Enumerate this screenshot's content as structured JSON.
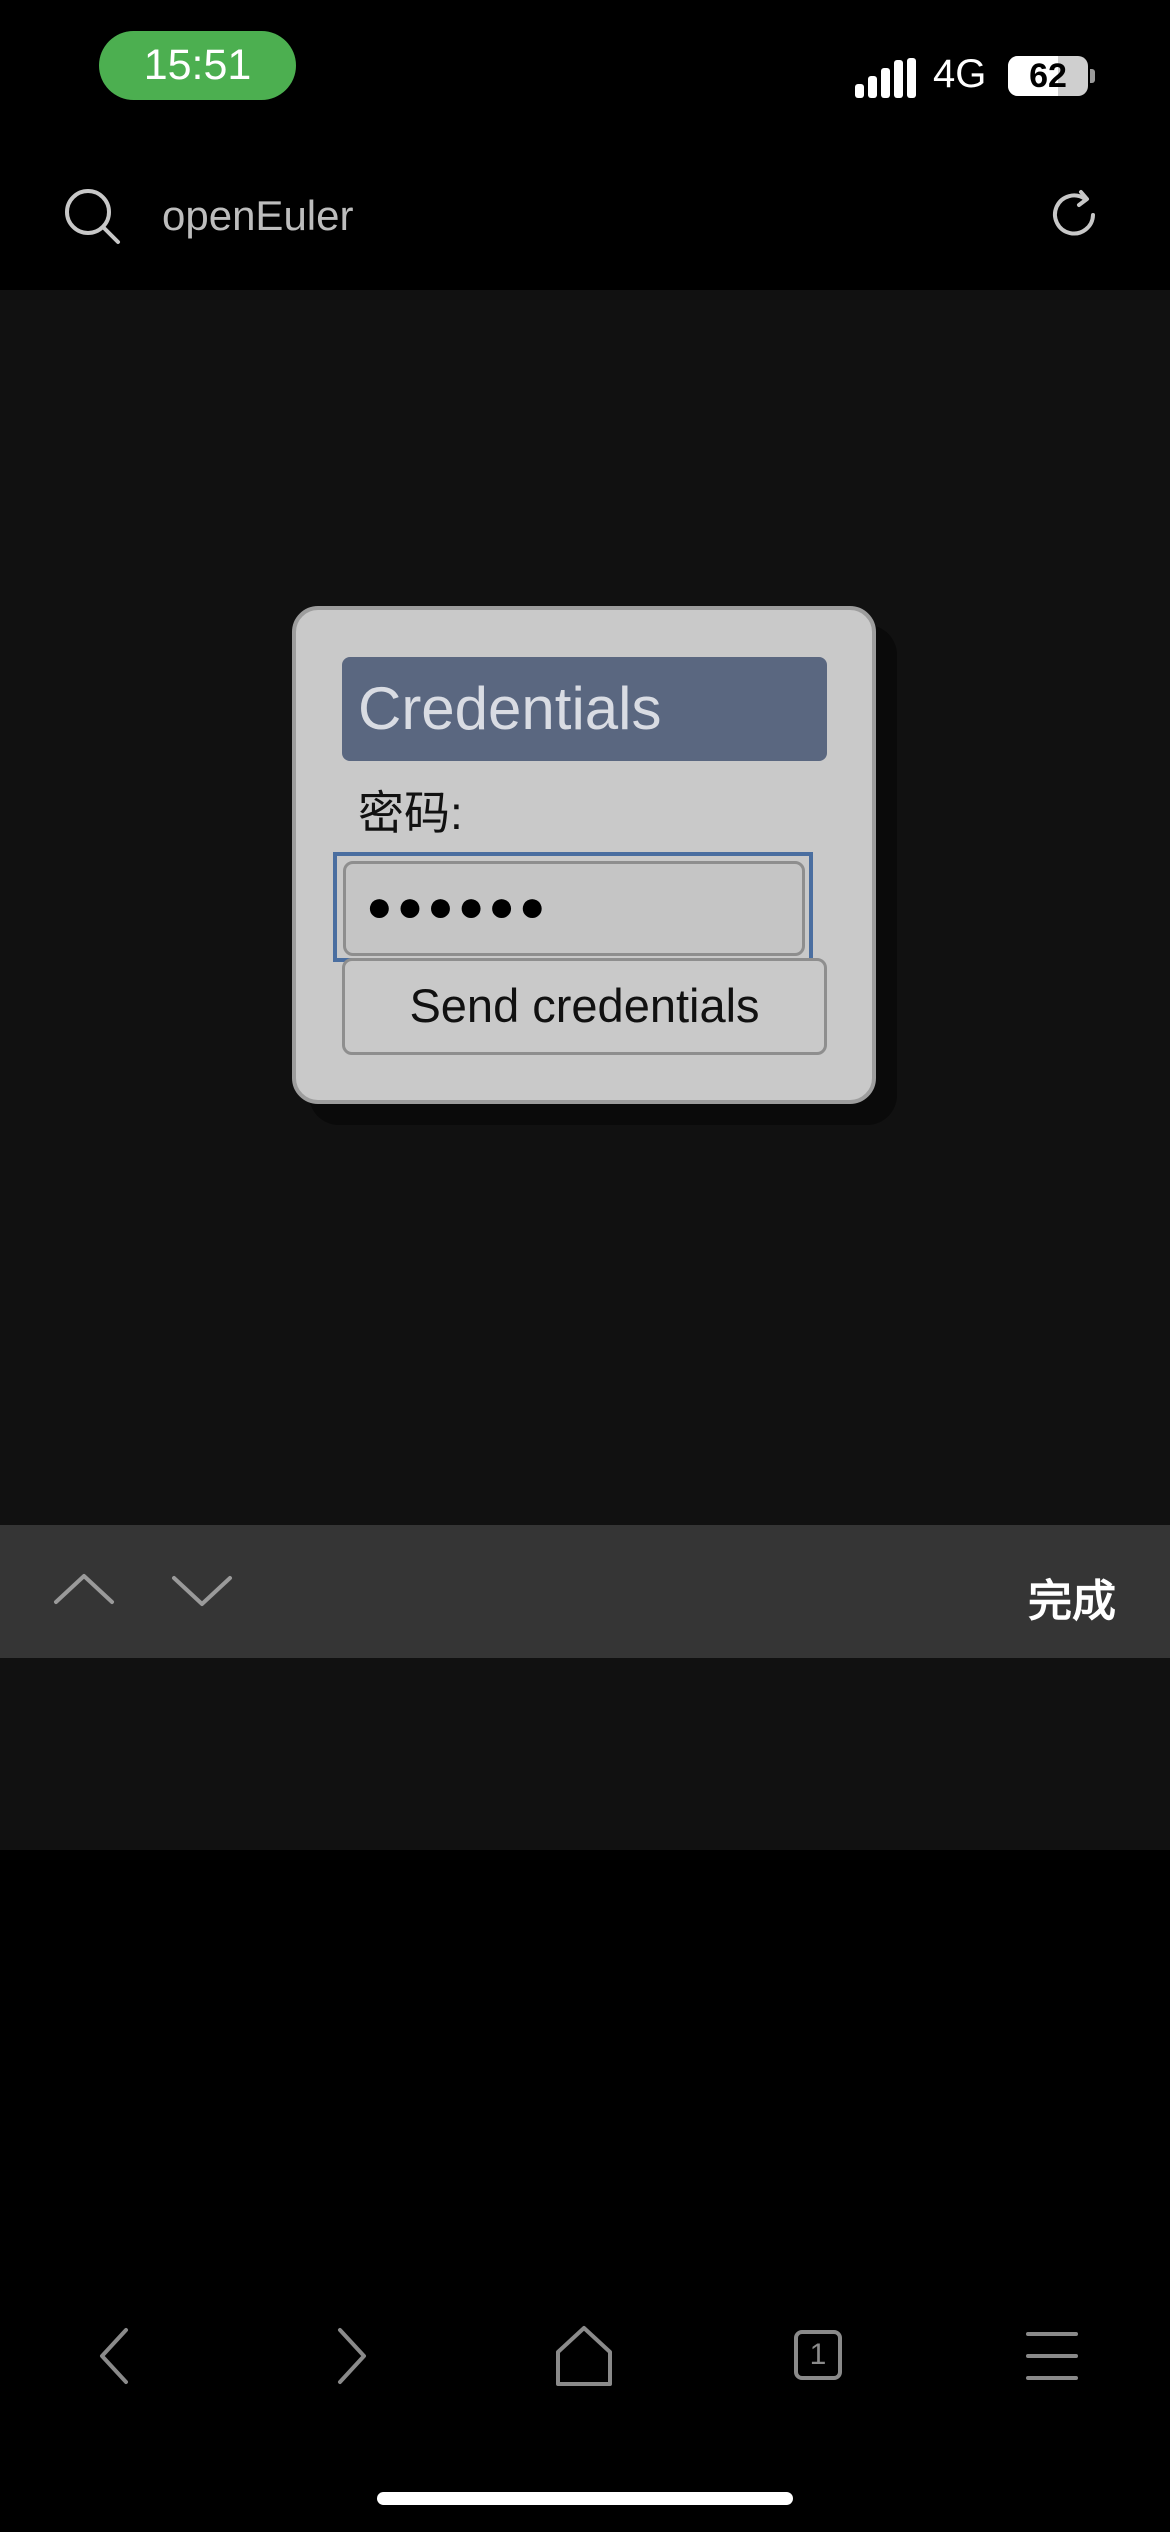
{
  "status_bar": {
    "time": "15:51",
    "network": "4G",
    "battery_level": "62",
    "battery_fraction": 0.62
  },
  "address_bar": {
    "text": "openEuler",
    "icons": [
      "search-icon",
      "refresh-icon"
    ]
  },
  "dialog": {
    "title": "Credentials",
    "password_label": "密码:",
    "password_value": "●●●●●●",
    "send_button_label": "Send credentials"
  },
  "accessory_bar": {
    "done_label": "完成",
    "icons": [
      "chevron-up-icon",
      "chevron-down-icon"
    ]
  },
  "toolbar": {
    "tab_count": "1",
    "icons": [
      "back-icon",
      "forward-icon",
      "home-icon",
      "tabs-icon",
      "menu-icon"
    ]
  },
  "colors": {
    "time_pill": "#4caf50",
    "dialog_title_bg": "#5a6780",
    "focus_ring": "#4a6ea0"
  }
}
